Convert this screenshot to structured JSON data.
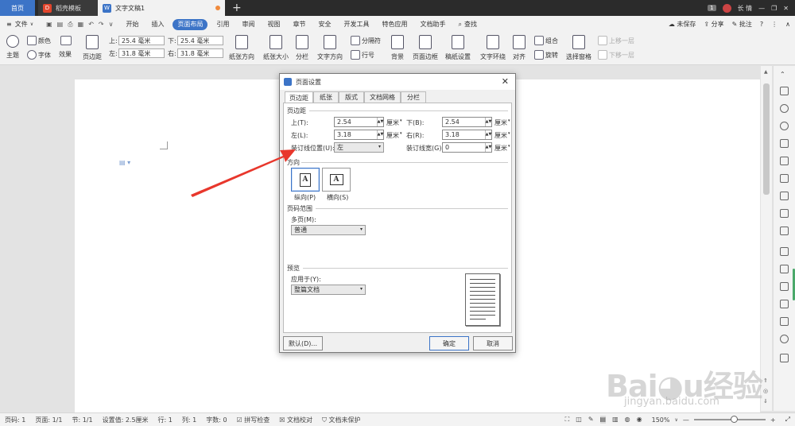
{
  "tabs": {
    "home": "首页",
    "template": "稻壳模板",
    "doc": "文字文稿1",
    "plus": "+"
  },
  "window": {
    "badge": "1",
    "user": "长 情"
  },
  "menu": {
    "file": "文件",
    "items": [
      "开始",
      "插入",
      "页面布局",
      "引用",
      "审阅",
      "视图",
      "章节",
      "安全",
      "开发工具",
      "特色应用",
      "文档助手"
    ],
    "active": "页面布局",
    "search": "查找",
    "unsaved": "未保存",
    "share": "分享",
    "comment": "批注",
    "help": "?"
  },
  "ribbon": {
    "theme": "主题",
    "colors": "颜色",
    "fonts": "字体",
    "effects": "效果",
    "margins": "页边距",
    "top_label": "上:",
    "top_val": "25.4 毫米",
    "bottom_label": "下:",
    "bottom_val": "25.4 毫米",
    "left_label": "左:",
    "left_val": "31.8 毫米",
    "right_label": "右:",
    "right_val": "31.8 毫米",
    "orientation": "纸张方向",
    "size": "纸张大小",
    "columns": "分栏",
    "text_dir": "文字方向",
    "line_num": "行号",
    "breaks": "分隔符",
    "background": "背景",
    "border": "页面边框",
    "grid": "稿纸设置",
    "wrap": "文字环绕",
    "align": "对齐",
    "rotate": "旋转",
    "group": "组合",
    "select_pane": "选择窗格",
    "up_one": "上移一层",
    "down_one": "下移一层"
  },
  "dialog": {
    "title": "页面设置",
    "tabs": [
      "页边距",
      "纸张",
      "版式",
      "文档网格",
      "分栏"
    ],
    "margins_group": "页边距",
    "top_lbl": "上(T):",
    "top_val": "2.54",
    "bottom_lbl": "下(B):",
    "bottom_val": "2.54",
    "left_lbl": "左(L):",
    "left_val": "3.18",
    "right_lbl": "右(R):",
    "right_val": "3.18",
    "unit": "厘米",
    "gutter_pos_lbl": "装订线位置(U):",
    "gutter_pos_val": "左",
    "gutter_lbl": "装订线宽(G):",
    "gutter_val": "0",
    "orient_group": "方向",
    "portrait": "纵向(P)",
    "landscape": "横向(S)",
    "pages_group": "页码范围",
    "multi_lbl": "多页(M):",
    "multi_val": "普通",
    "preview_group": "预览",
    "apply_lbl": "应用于(Y):",
    "apply_val": "整篇文档",
    "default_btn": "默认(D)...",
    "ok_btn": "确定",
    "cancel_btn": "取消"
  },
  "status": {
    "page": "页码: 1",
    "pages": "页面: 1/1",
    "section": "节: 1/1",
    "setting": "设置值: 2.5厘米",
    "row": "行: 1",
    "col": "列: 1",
    "words": "字数: 0",
    "spell": "拼写检查",
    "proof": "文档校对",
    "protect": "文档未保护",
    "zoom": "150%"
  },
  "colors": {
    "accent": "#3c74c7",
    "arrow": "#e8372c"
  }
}
